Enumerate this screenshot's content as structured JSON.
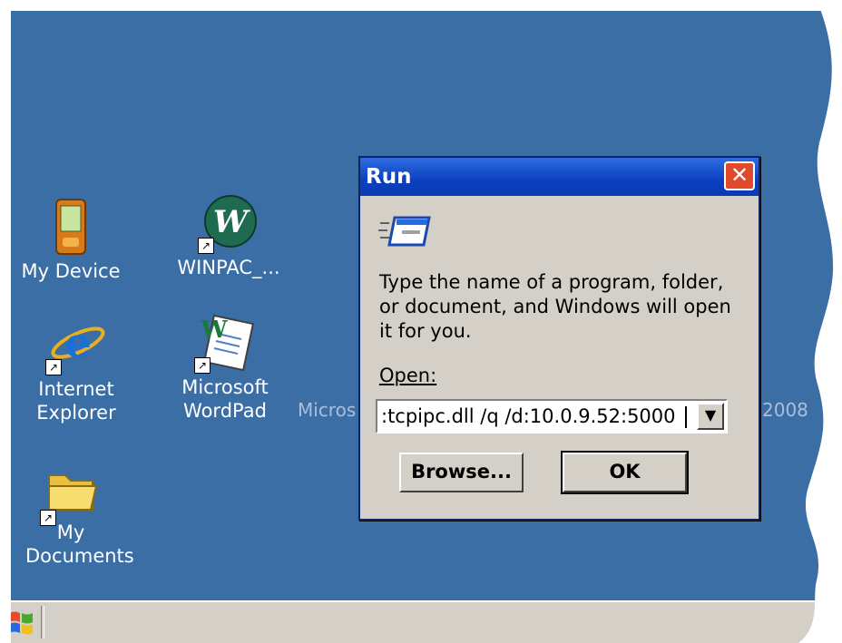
{
  "desktop": {
    "icons": [
      {
        "label": "My Device"
      },
      {
        "label": "WINPAC_..."
      },
      {
        "label": "Internet Explorer"
      },
      {
        "label": "Microsoft WordPad"
      },
      {
        "label": "My Documents"
      }
    ],
    "background_text_left": "Micros",
    "background_text_right": "2008"
  },
  "run_dialog": {
    "title": "Run",
    "close_label": "✕",
    "description": "Type the name of a program, folder, or document, and Windows will open it for you.",
    "open_label": "Open:",
    "command_value": ":tcpipc.dll /q /d:10.0.9.52:5000",
    "browse_label": "Browse...",
    "ok_label": "OK"
  },
  "colors": {
    "desktop": "#3a6ea5",
    "titlebar": "#0a3fbf",
    "close": "#e04a2a",
    "dialog_face": "#d4d0c8"
  }
}
